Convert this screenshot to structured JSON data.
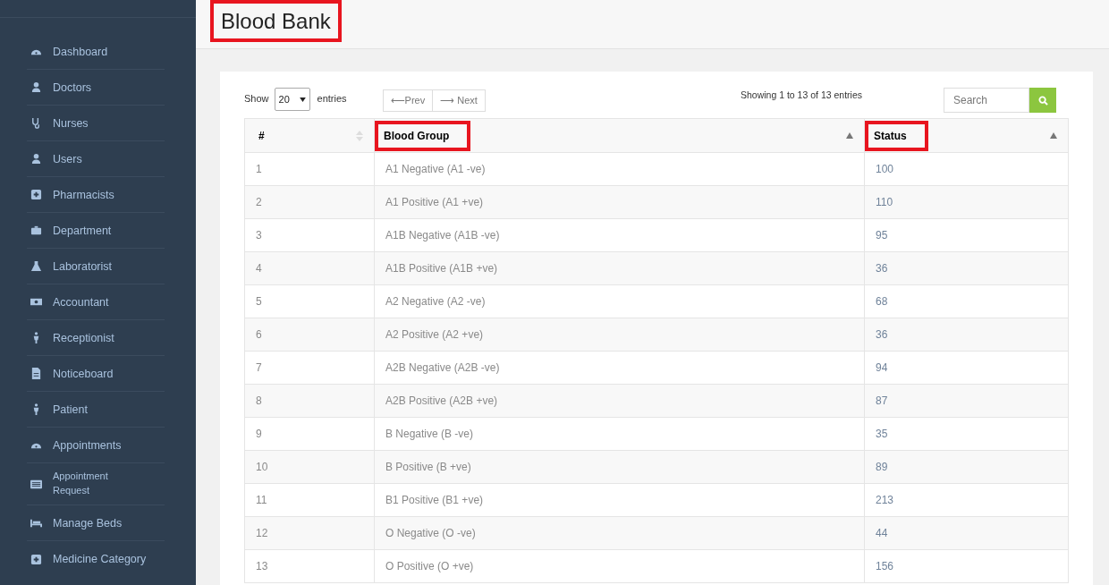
{
  "sidebar": {
    "items": [
      {
        "label": "Dashboard",
        "compact": false
      },
      {
        "label": "Doctors",
        "compact": false
      },
      {
        "label": "Nurses",
        "compact": false
      },
      {
        "label": "Users",
        "compact": false
      },
      {
        "label": "Pharmacists",
        "compact": false
      },
      {
        "label": "Department",
        "compact": false
      },
      {
        "label": "Laboratorist",
        "compact": false
      },
      {
        "label": "Accountant",
        "compact": false
      },
      {
        "label": "Receptionist",
        "compact": false
      },
      {
        "label": "Noticeboard",
        "compact": false
      },
      {
        "label": "Patient",
        "compact": false
      },
      {
        "label": "Appointments",
        "compact": false
      },
      {
        "label": "Appointment Request",
        "compact": true
      },
      {
        "label": "Manage Beds",
        "compact": false
      },
      {
        "label": "Medicine Category",
        "compact": false
      }
    ]
  },
  "page": {
    "title": "Blood Bank",
    "title_highlighted": true
  },
  "table_controls": {
    "show_label": "Show",
    "page_size": "20",
    "entries_label": "entries",
    "prev": "⟵Prev",
    "next": "⟶ Next",
    "info": "Showing 1 to 13 of 13 entries",
    "search": {
      "placeholder": "Search"
    }
  },
  "table": {
    "columns": [
      {
        "label": "#",
        "sorted": false,
        "highlighted": false
      },
      {
        "label": "Blood Group",
        "sorted": true,
        "highlighted": true
      },
      {
        "label": "Status",
        "sorted": true,
        "highlighted": true
      }
    ],
    "rows": [
      [
        "1",
        "A1 Negative (A1 -ve)",
        "100"
      ],
      [
        "2",
        "A1 Positive (A1 +ve)",
        "110"
      ],
      [
        "3",
        "A1B Negative (A1B -ve)",
        "95"
      ],
      [
        "4",
        "A1B Positive (A1B +ve)",
        "36"
      ],
      [
        "5",
        "A2 Negative (A2 -ve)",
        "68"
      ],
      [
        "6",
        "A2 Positive (A2 +ve)",
        "36"
      ],
      [
        "7",
        "A2B Negative (A2B -ve)",
        "94"
      ],
      [
        "8",
        "A2B Positive (A2B +ve)",
        "87"
      ],
      [
        "9",
        "B Negative (B -ve)",
        "35"
      ],
      [
        "10",
        "B Positive (B +ve)",
        "89"
      ],
      [
        "11",
        "B1 Positive (B1 +ve)",
        "213"
      ],
      [
        "12",
        "O Negative (O -ve)",
        "44"
      ],
      [
        "13",
        "O Positive (O +ve)",
        "156"
      ]
    ]
  }
}
